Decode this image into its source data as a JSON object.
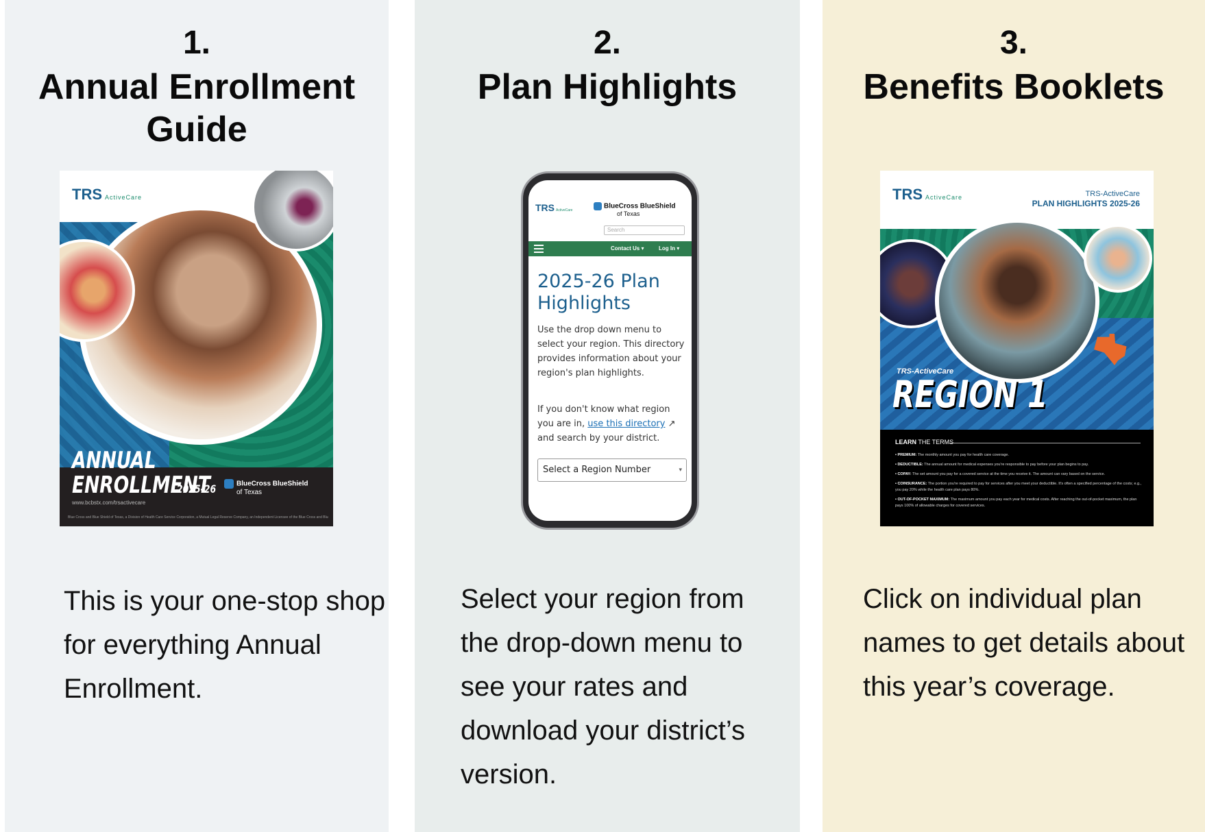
{
  "panels": [
    {
      "number": "1.",
      "title": "Annual Enrollment Guide",
      "description": "This is your one-stop shop for everything Annual Enrollment."
    },
    {
      "number": "2.",
      "title": "Plan Highlights",
      "description": "Select your region from the drop-down menu to see your rates and download your district’s version."
    },
    {
      "number": "3.",
      "title": "Benefits Booklets",
      "description": "Click on individual plan names to get details about this year’s coverage."
    }
  ],
  "enrollment_cover": {
    "logo": "TRS",
    "logo_sub": "ActiveCare",
    "heading": "ANNUAL ENROLLMENT",
    "year": "2025-26",
    "insurer": "BlueCross BlueShield",
    "insurer_sub": "of Texas",
    "url": "www.bcbstx.com/trsactivecare",
    "fine_print": "Blue Cross and Blue Shield of Texas, a Division of Health Care Service Corporation, a Mutual Legal Reserve Company, an Independent Licensee of the Blue Cross and Blue Shield Association"
  },
  "phone": {
    "logo": "TRS",
    "logo_sub": "ActiveCare",
    "insurer": "BlueCross BlueShield",
    "insurer_sub": "of Texas",
    "search_placeholder": "Search",
    "nav_contact": "Contact Us ▾",
    "nav_login": "Log In ▾",
    "heading": "2025-26 Plan Highlights",
    "para1": "Use the drop down menu to select your region. This directory provides information about your region's plan highlights.",
    "para2_a": "If you don't know what region you are in, ",
    "para2_link": "use this directory",
    "para2_b": " ↗ and search by your district.",
    "select_value": "Select a Region Number",
    "select_caret": "▾"
  },
  "booklet_cover": {
    "logo": "TRS",
    "logo_sub": "ActiveCare",
    "top_line1": "TRS-ActiveCare",
    "top_line2": "PLAN HIGHLIGHTS 2025-26",
    "subheading": "TRS-ActiveCare",
    "region": "REGION 1",
    "learn": "LEARN",
    "learn_rest": " THE TERMS",
    "terms": [
      {
        "term": "• PREMIUM:",
        "def": " The monthly amount you pay for health care coverage."
      },
      {
        "term": "• DEDUCTIBLE:",
        "def": " The annual amount for medical expenses you're responsible to pay before your plan begins to pay."
      },
      {
        "term": "• COPAY:",
        "def": " The set amount you pay for a covered service at the time you receive it. The amount can vary based on the service."
      },
      {
        "term": "• COINSURANCE:",
        "def": " The portion you're required to pay for services after you meet your deductible. It's often a specified percentage of the costs; e.g., you pay 20% while the health care plan pays 80%."
      },
      {
        "term": "• OUT-OF-POCKET MAXIMUM:",
        "def": " The maximum amount you pay each year for medical costs. After reaching the out-of-pocket maximum, the plan pays 100% of allowable charges for covered services."
      }
    ]
  }
}
